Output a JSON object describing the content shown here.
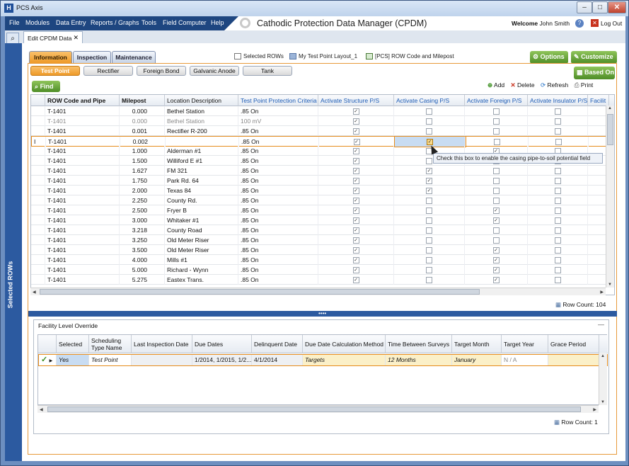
{
  "window": {
    "title": "PCS Axis",
    "app_icon": "H"
  },
  "menu": {
    "items": [
      "File",
      "Modules",
      "Data Entry",
      "Reports / Graphs",
      "Tools",
      "Field Computer",
      "Help"
    ]
  },
  "app_title": "Cathodic Protection Data Manager (CPDM)",
  "user": {
    "welcome": "Welcome",
    "name": "John Smith",
    "logout": "Log Out"
  },
  "doc_tab": {
    "label": "Edit CPDM Data",
    "close": "✕"
  },
  "side_panel": {
    "label": "Selected ROWs"
  },
  "top_tabs": [
    {
      "label": "Information",
      "active": true
    },
    {
      "label": "Inspection",
      "active": false
    },
    {
      "label": "Maintenance",
      "active": false
    }
  ],
  "info_items": {
    "selected_rows": "Selected ROWs",
    "layout": "My Test Point Layout_1",
    "pcs_row": "[PCS] ROW Code and Milepost"
  },
  "buttons": {
    "options": "Options",
    "customize": "Customize",
    "based_on": "Based On",
    "find": "Find",
    "add": "Add",
    "delete": "Delete",
    "refresh": "Refresh",
    "print": "Print"
  },
  "sub_tabs": [
    {
      "label": "Test Point",
      "active": true
    },
    {
      "label": "Rectifier",
      "active": false
    },
    {
      "label": "Foreign Bond",
      "active": false
    },
    {
      "label": "Galvanic Anode",
      "active": false
    },
    {
      "label": "Tank",
      "active": false
    }
  ],
  "grid": {
    "columns": [
      "ROW Code and Pipe",
      "Milepost",
      "Location Description",
      "Test Point Protection Criteria",
      "Activate Structure P/S",
      "Activate Casing P/S",
      "Activate Foreign P/S",
      "Activate Insulator P/S",
      "Facilit"
    ],
    "rows": [
      {
        "row": "T-1401",
        "mp": "0.000",
        "loc": "Bethel Station",
        "crit": ".85 On",
        "s": true,
        "c": false,
        "f": false,
        "i": false,
        "dim": false,
        "sel": false
      },
      {
        "row": "T-1401",
        "mp": "0.000",
        "loc": "Bethel Station",
        "crit": "100 mV",
        "s": true,
        "c": false,
        "f": false,
        "i": false,
        "dim": true,
        "sel": false
      },
      {
        "row": "T-1401",
        "mp": "0.001",
        "loc": "Rectifier R-200",
        "crit": ".85 On",
        "s": true,
        "c": false,
        "f": false,
        "i": false,
        "dim": false,
        "sel": false
      },
      {
        "row": "T-1401",
        "mp": "0.002",
        "loc": "",
        "crit": ".85 On",
        "s": true,
        "c": true,
        "f": false,
        "i": false,
        "dim": false,
        "sel": true
      },
      {
        "row": "T-1401",
        "mp": "1.000",
        "loc": "Alderman #1",
        "crit": ".85 On",
        "s": true,
        "c": false,
        "f": true,
        "i": false,
        "dim": false,
        "sel": false
      },
      {
        "row": "T-1401",
        "mp": "1.500",
        "loc": "Williford E #1",
        "crit": ".85 On",
        "s": true,
        "c": false,
        "f": false,
        "i": false,
        "dim": false,
        "sel": false
      },
      {
        "row": "T-1401",
        "mp": "1.627",
        "loc": "FM 321",
        "crit": ".85 On",
        "s": true,
        "c": true,
        "f": false,
        "i": false,
        "dim": false,
        "sel": false
      },
      {
        "row": "T-1401",
        "mp": "1.750",
        "loc": "Park Rd. 64",
        "crit": ".85 On",
        "s": true,
        "c": true,
        "f": false,
        "i": false,
        "dim": false,
        "sel": false
      },
      {
        "row": "T-1401",
        "mp": "2.000",
        "loc": "Texas 84",
        "crit": ".85 On",
        "s": true,
        "c": true,
        "f": false,
        "i": false,
        "dim": false,
        "sel": false
      },
      {
        "row": "T-1401",
        "mp": "2.250",
        "loc": "County Rd.",
        "crit": ".85 On",
        "s": true,
        "c": false,
        "f": false,
        "i": false,
        "dim": false,
        "sel": false
      },
      {
        "row": "T-1401",
        "mp": "2.500",
        "loc": "Fryer B",
        "crit": ".85 On",
        "s": true,
        "c": false,
        "f": true,
        "i": false,
        "dim": false,
        "sel": false
      },
      {
        "row": "T-1401",
        "mp": "3.000",
        "loc": "Whitaker #1",
        "crit": ".85 On",
        "s": true,
        "c": false,
        "f": true,
        "i": false,
        "dim": false,
        "sel": false
      },
      {
        "row": "T-1401",
        "mp": "3.218",
        "loc": "County Road",
        "crit": ".85 On",
        "s": true,
        "c": false,
        "f": false,
        "i": false,
        "dim": false,
        "sel": false
      },
      {
        "row": "T-1401",
        "mp": "3.250",
        "loc": "Old Meter Riser",
        "crit": ".85 On",
        "s": true,
        "c": false,
        "f": false,
        "i": false,
        "dim": false,
        "sel": false
      },
      {
        "row": "T-1401",
        "mp": "3.500",
        "loc": "Old Meter Riser",
        "crit": ".85 On",
        "s": true,
        "c": false,
        "f": true,
        "i": false,
        "dim": false,
        "sel": false
      },
      {
        "row": "T-1401",
        "mp": "4.000",
        "loc": "Mills #1",
        "crit": ".85 On",
        "s": true,
        "c": false,
        "f": true,
        "i": false,
        "dim": false,
        "sel": false
      },
      {
        "row": "T-1401",
        "mp": "5.000",
        "loc": "Richard - Wynn",
        "crit": ".85 On",
        "s": true,
        "c": false,
        "f": true,
        "i": false,
        "dim": false,
        "sel": false
      },
      {
        "row": "T-1401",
        "mp": "5.275",
        "loc": "Eastex Trans.",
        "crit": ".85 On",
        "s": true,
        "c": false,
        "f": true,
        "i": false,
        "dim": false,
        "sel": false
      }
    ],
    "row_count": "Row Count: 104",
    "tooltip": "Check this box to enable the casing pipe-to-soil potential field",
    "row_marker": "I"
  },
  "facility_override": {
    "title": "Facility Level Override",
    "columns": [
      "Selected",
      "Scheduling Type Name",
      "Last Inspection Date",
      "Due Dates",
      "Delinquent Date",
      "Due Date Calculation Method",
      "Time Between Surveys",
      "Target Month",
      "Target Year",
      "Grace Period"
    ],
    "row": {
      "selected": "Yes",
      "sched": "Test Point",
      "last": "",
      "due": "1/2014, 1/2015, 1/2...",
      "delinquent": "4/1/2014",
      "method": "Targets",
      "time": "12 Months",
      "month": "January",
      "year": "N / A",
      "grace": ""
    },
    "row_count": "Row Count: 1"
  },
  "colors": {
    "accent": "#ee9a28",
    "brand": "#1e4680",
    "green": "#4e8d27"
  }
}
